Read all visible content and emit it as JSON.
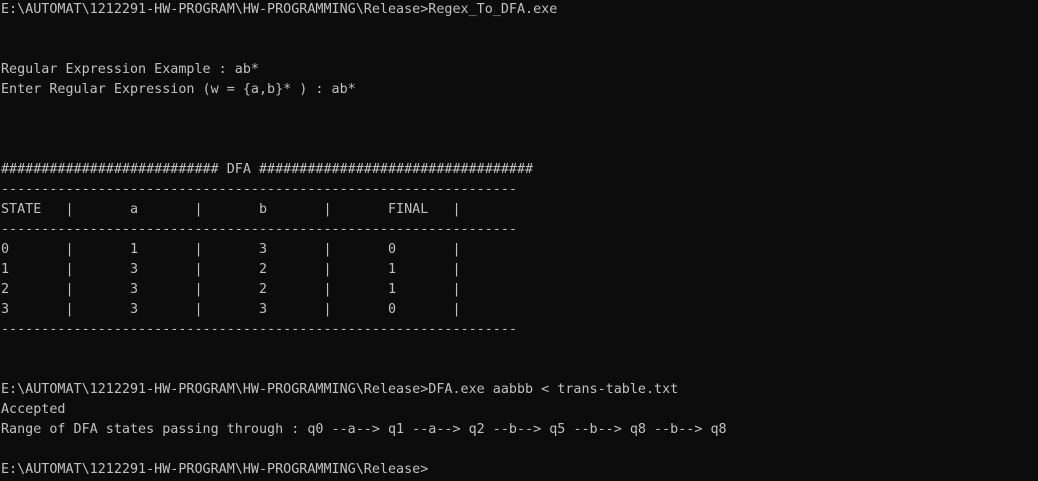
{
  "console": {
    "line_01": "E:\\AUTOMAT\\1212291-HW-PROGRAM\\HW-PROGRAMMING\\Release>Regex_To_DFA.exe",
    "line_04": "Regular Expression Example : ab*",
    "line_05": "Enter Regular Expression (w = {a,b}* ) : ab*",
    "line_09": "########################### DFA ##################################",
    "line_10": "----------------------------------------------------------------",
    "line_11": "STATE   |       a       |       b       |       FINAL   |",
    "line_12": "----------------------------------------------------------------",
    "line_13": "0       |       1       |       3       |       0       |",
    "line_14": "1       |       3       |       2       |       1       |",
    "line_15": "2       |       3       |       2       |       1       |",
    "line_16": "3       |       3       |       3       |       0       |",
    "line_17": "----------------------------------------------------------------",
    "line_20": "E:\\AUTOMAT\\1212291-HW-PROGRAM\\HW-PROGRAMMING\\Release>DFA.exe aabbb < trans-table.txt",
    "line_21": "Accepted",
    "line_22": "Range of DFA states passing through : q0 --a--> q1 --a--> q2 --b--> q5 --b--> q8 --b--> q8",
    "line_24": "E:\\AUTOMAT\\1212291-HW-PROGRAM\\HW-PROGRAMMING\\Release>"
  }
}
